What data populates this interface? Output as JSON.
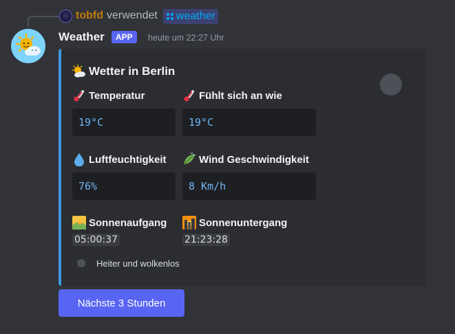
{
  "reply": {
    "username": "tobfd",
    "verb": "verwendet",
    "command": "weather"
  },
  "author": {
    "name": "Weather",
    "badge": "APP",
    "timestamp": "heute um 22:27 Uhr"
  },
  "embed": {
    "accent_color": "#3d9ae0",
    "title": "Wetter in Berlin",
    "fields": [
      {
        "name": "Temperatur",
        "value": "19°C",
        "icon": "thermometer-icon"
      },
      {
        "name": "Fühlt sich an wie",
        "value": "19°C",
        "icon": "thermometer-icon"
      },
      {
        "name": "Luftfeuchtigkeit",
        "value": "76%",
        "icon": "droplet-icon"
      },
      {
        "name": "Wind Geschwindigkeit",
        "value": "8 Km/h",
        "icon": "wind-leaf-icon"
      },
      {
        "name": "Sonnenaufgang",
        "value": "05:00:37",
        "icon": "sunrise-icon"
      },
      {
        "name": "Sonnenuntergang",
        "value": "21:23:28",
        "icon": "sunset-icon"
      }
    ],
    "footer": "Heiter und wolkenlos"
  },
  "button": {
    "label": "Nächste 3 Stunden"
  }
}
